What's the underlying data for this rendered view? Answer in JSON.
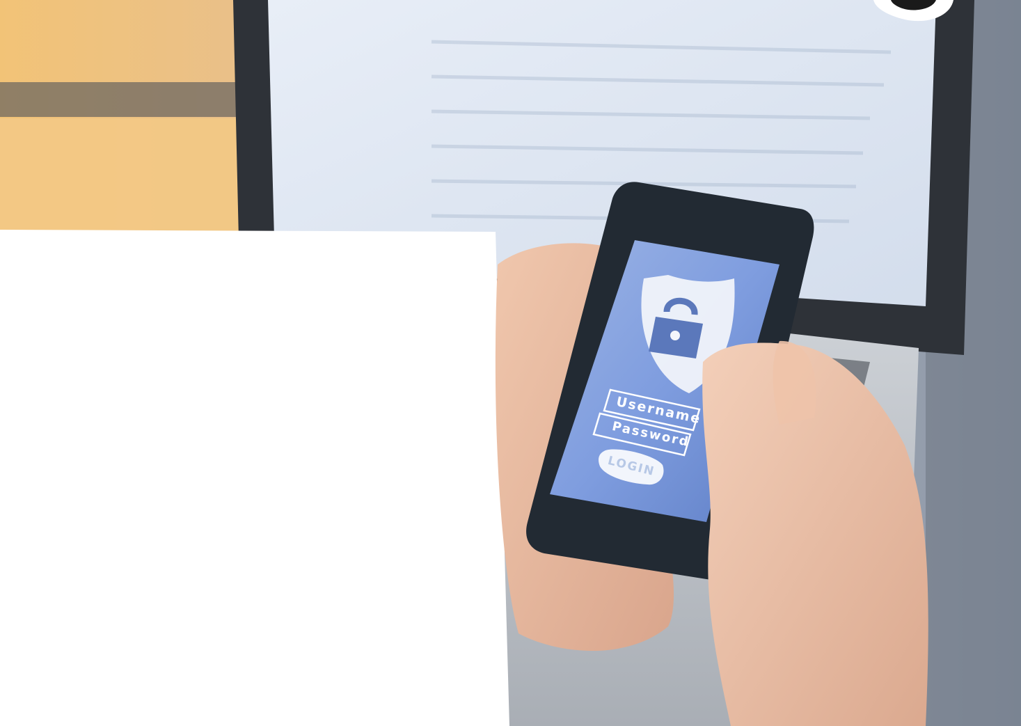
{
  "phone_login_screen": {
    "username_field_text": "Username",
    "password_field_text": "Password",
    "login_button_text": "LOGIN",
    "icon": "shield-lock-icon"
  },
  "colors": {
    "screen_blue": "#7f9ddf",
    "phone_body": "#222a33",
    "skin": "#e6b79f",
    "window_glow": "#f1c27a"
  }
}
